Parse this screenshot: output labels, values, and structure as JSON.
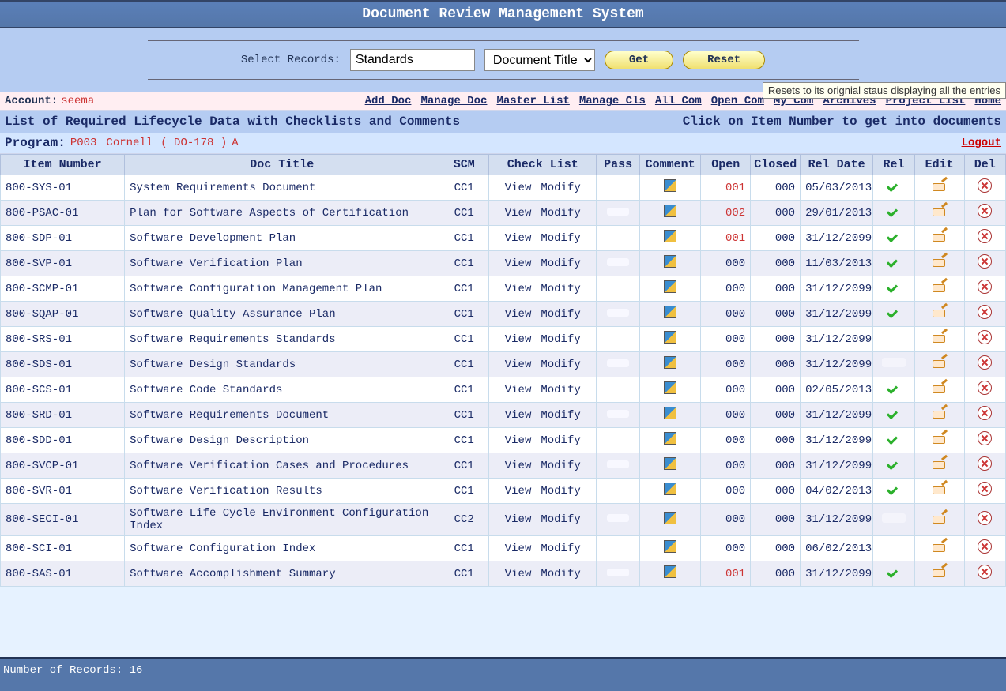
{
  "title": "Document Review Management System",
  "filter": {
    "label": "Select Records:",
    "text_value": "Standards",
    "select_value": "Document Title",
    "get_label": "Get",
    "reset_label": "Reset",
    "reset_tooltip": "Resets to its orignial staus displaying all the entries"
  },
  "account": {
    "label": "Account:",
    "user": "seema"
  },
  "nav": [
    "Add Doc",
    "Manage Doc",
    "Master List",
    "Manage Cls",
    "All Com",
    "Open Com",
    "My Com",
    "Archives",
    "Project List",
    "Home"
  ],
  "subhead_left": "List of Required Lifecycle Data with Checklists and Comments",
  "subhead_right": "Click on Item Number to get into documents",
  "program": {
    "label": "Program:",
    "code": "P003",
    "name": "Cornell",
    "std": "( DO-178 )",
    "rev": "A"
  },
  "logout": "Logout",
  "columns": [
    "Item Number",
    "Doc Title",
    "SCM",
    "Check List",
    "Pass",
    "Comment",
    "Open",
    "Closed",
    "Rel Date",
    "Rel",
    "Edit",
    "Del"
  ],
  "checklist_view": "View",
  "checklist_modify": "Modify",
  "rows": [
    {
      "item": "800-SYS-01",
      "title": "System Requirements Document",
      "scm": "CC1",
      "pass": "",
      "open": "001",
      "closed": "000",
      "reldate": "05/03/2013",
      "rel": true
    },
    {
      "item": "800-PSAC-01",
      "title": "Plan for Software Aspects of Certification",
      "scm": "CC1",
      "pass": "blank",
      "open": "002",
      "closed": "000",
      "reldate": "29/01/2013",
      "rel": true
    },
    {
      "item": "800-SDP-01",
      "title": "Software Development Plan",
      "scm": "CC1",
      "pass": "",
      "open": "001",
      "closed": "000",
      "reldate": "31/12/2099",
      "rel": true
    },
    {
      "item": "800-SVP-01",
      "title": "Software Verification Plan",
      "scm": "CC1",
      "pass": "blank",
      "open": "000",
      "closed": "000",
      "reldate": "11/03/2013",
      "rel": true
    },
    {
      "item": "800-SCMP-01",
      "title": "Software Configuration Management Plan",
      "scm": "CC1",
      "pass": "",
      "open": "000",
      "closed": "000",
      "reldate": "31/12/2099",
      "rel": true
    },
    {
      "item": "800-SQAP-01",
      "title": "Software Quality Assurance Plan",
      "scm": "CC1",
      "pass": "blank",
      "open": "000",
      "closed": "000",
      "reldate": "31/12/2099",
      "rel": true
    },
    {
      "item": "800-SRS-01",
      "title": "Software Requirements Standards",
      "scm": "CC1",
      "pass": "",
      "open": "000",
      "closed": "000",
      "reldate": "31/12/2099",
      "rel": false
    },
    {
      "item": "800-SDS-01",
      "title": "Software Design Standards",
      "scm": "CC1",
      "pass": "blank",
      "open": "000",
      "closed": "000",
      "reldate": "31/12/2099",
      "rel": "blank"
    },
    {
      "item": "800-SCS-01",
      "title": "Software Code Standards",
      "scm": "CC1",
      "pass": "",
      "open": "000",
      "closed": "000",
      "reldate": "02/05/2013",
      "rel": true
    },
    {
      "item": "800-SRD-01",
      "title": "Software Requirements Document",
      "scm": "CC1",
      "pass": "blank",
      "open": "000",
      "closed": "000",
      "reldate": "31/12/2099",
      "rel": true
    },
    {
      "item": "800-SDD-01",
      "title": "Software Design Description",
      "scm": "CC1",
      "pass": "",
      "open": "000",
      "closed": "000",
      "reldate": "31/12/2099",
      "rel": true
    },
    {
      "item": "800-SVCP-01",
      "title": "Software Verification Cases and Procedures",
      "scm": "CC1",
      "pass": "blank",
      "open": "000",
      "closed": "000",
      "reldate": "31/12/2099",
      "rel": true
    },
    {
      "item": "800-SVR-01",
      "title": "Software Verification Results",
      "scm": "CC1",
      "pass": "",
      "open": "000",
      "closed": "000",
      "reldate": "04/02/2013",
      "rel": true
    },
    {
      "item": "800-SECI-01",
      "title": "Software Life Cycle Environment Configuration Index",
      "scm": "CC2",
      "pass": "blank",
      "open": "000",
      "closed": "000",
      "reldate": "31/12/2099",
      "rel": "blank"
    },
    {
      "item": "800-SCI-01",
      "title": "Software Configuration Index",
      "scm": "CC1",
      "pass": "",
      "open": "000",
      "closed": "000",
      "reldate": "06/02/2013",
      "rel": false
    },
    {
      "item": "800-SAS-01",
      "title": "Software Accomplishment Summary",
      "scm": "CC1",
      "pass": "blank",
      "open": "001",
      "closed": "000",
      "reldate": "31/12/2099",
      "rel": true
    }
  ],
  "footer": {
    "label": "Number of Records:",
    "count": "16"
  }
}
